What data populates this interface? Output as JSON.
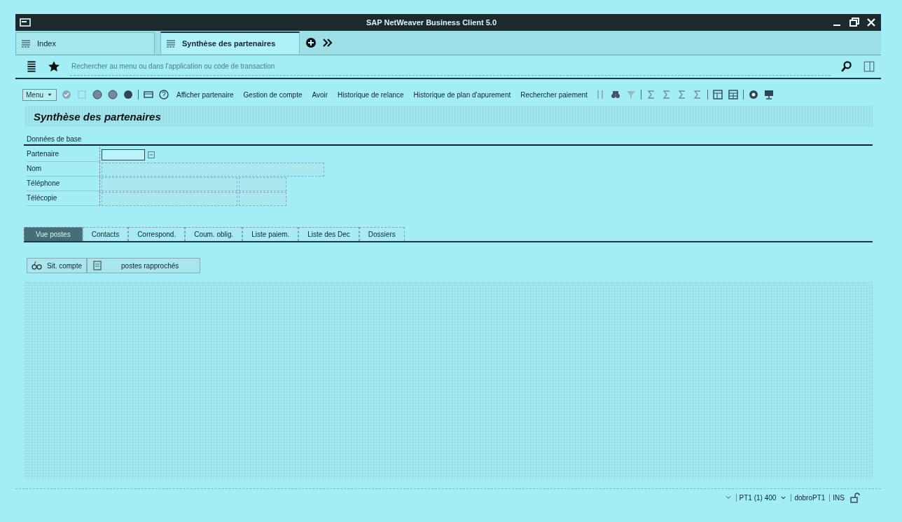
{
  "window": {
    "title": "SAP NetWeaver Business Client 5.0"
  },
  "tabs": [
    {
      "label": "Index",
      "selected": false
    },
    {
      "label": "Synthèse des partenaires",
      "selected": true
    }
  ],
  "search": {
    "placeholder": "Rechercher au menu ou dans l'application ou code de transaction"
  },
  "toolbar": {
    "menu": "Menu",
    "actions": [
      "Afficher partenaire",
      "Gestion de compte",
      "Avoir",
      "Historique de relance",
      "Historique de plan d'apurement",
      "Rechercher paiement"
    ]
  },
  "page_title": "Synthèse des partenaires",
  "section": "Données de base",
  "fields": [
    {
      "label": "Partenaire",
      "kind": "input"
    },
    {
      "label": "Nom",
      "kind": "wide"
    },
    {
      "label": "Téléphone",
      "kind": "split"
    },
    {
      "label": "Télécopie",
      "kind": "split"
    }
  ],
  "content_tabs": [
    {
      "label": "Vue postes",
      "selected": true
    },
    {
      "label": "Contacts",
      "selected": false
    },
    {
      "label": "Correspond.",
      "selected": false
    },
    {
      "label": "Coum. oblig.",
      "selected": false
    },
    {
      "label": "Liste paiem.",
      "selected": false
    },
    {
      "label": "Liste des Dec",
      "selected": false
    },
    {
      "label": "Dossiers",
      "selected": false
    }
  ],
  "buttons": [
    "Sit. compte",
    "postes rapprochés"
  ],
  "status_bar": {
    "system": "PT1 (1) 400",
    "host": "dobroPT1",
    "mode": "INS"
  }
}
